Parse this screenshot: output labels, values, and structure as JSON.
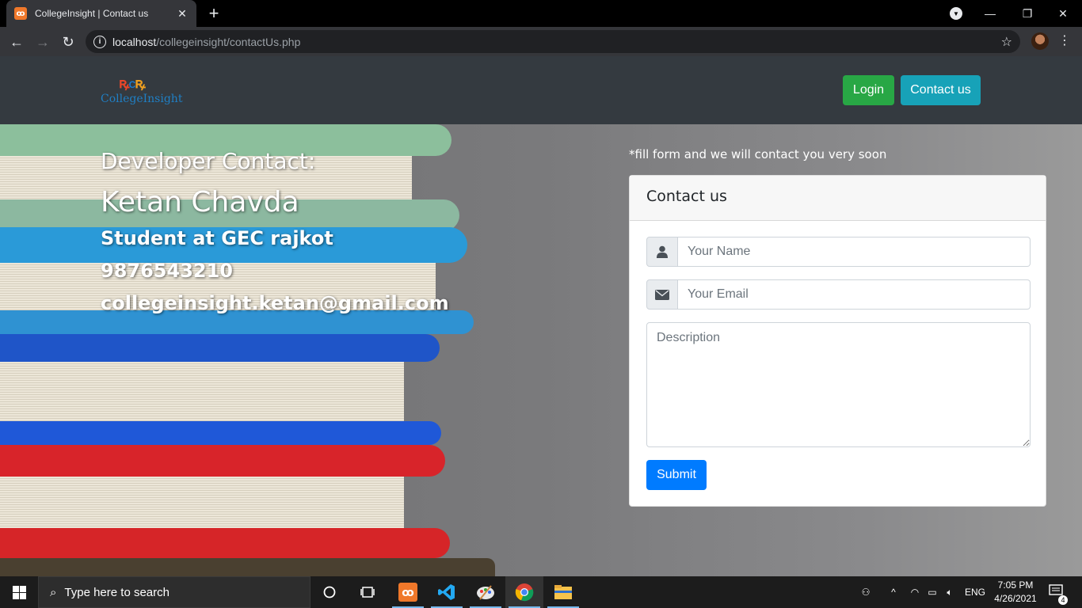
{
  "browser": {
    "tab_title": "CollegeInsight | Contact us",
    "tab_favicon_icon": "xampp-icon",
    "url_host": "localhost",
    "url_path": "/collegeinsight/contactUs.php"
  },
  "site": {
    "logo_text": "CollegeInsight",
    "nav": {
      "login_label": "Login",
      "contact_label": "Contact us"
    }
  },
  "developer": {
    "heading": "Developer Contact:",
    "name": "Ketan Chavda",
    "role": "Student at GEC rajkot",
    "phone": "9876543210",
    "email": "collegeinsight.ketan@gmail.com"
  },
  "form": {
    "hint": "*fill form and we will contact you very soon",
    "title": "Contact us",
    "name_placeholder": "Your Name",
    "email_placeholder": "Your Email",
    "description_placeholder": "Description",
    "submit_label": "Submit"
  },
  "taskbar": {
    "search_placeholder": "Type here to search",
    "language": "ENG",
    "time": "7:05 PM",
    "date": "4/26/2021",
    "notification_count": "4"
  },
  "colors": {
    "navbar": "#343a40",
    "login": "#28a745",
    "contact": "#17a2b8",
    "submit": "#007bff"
  }
}
